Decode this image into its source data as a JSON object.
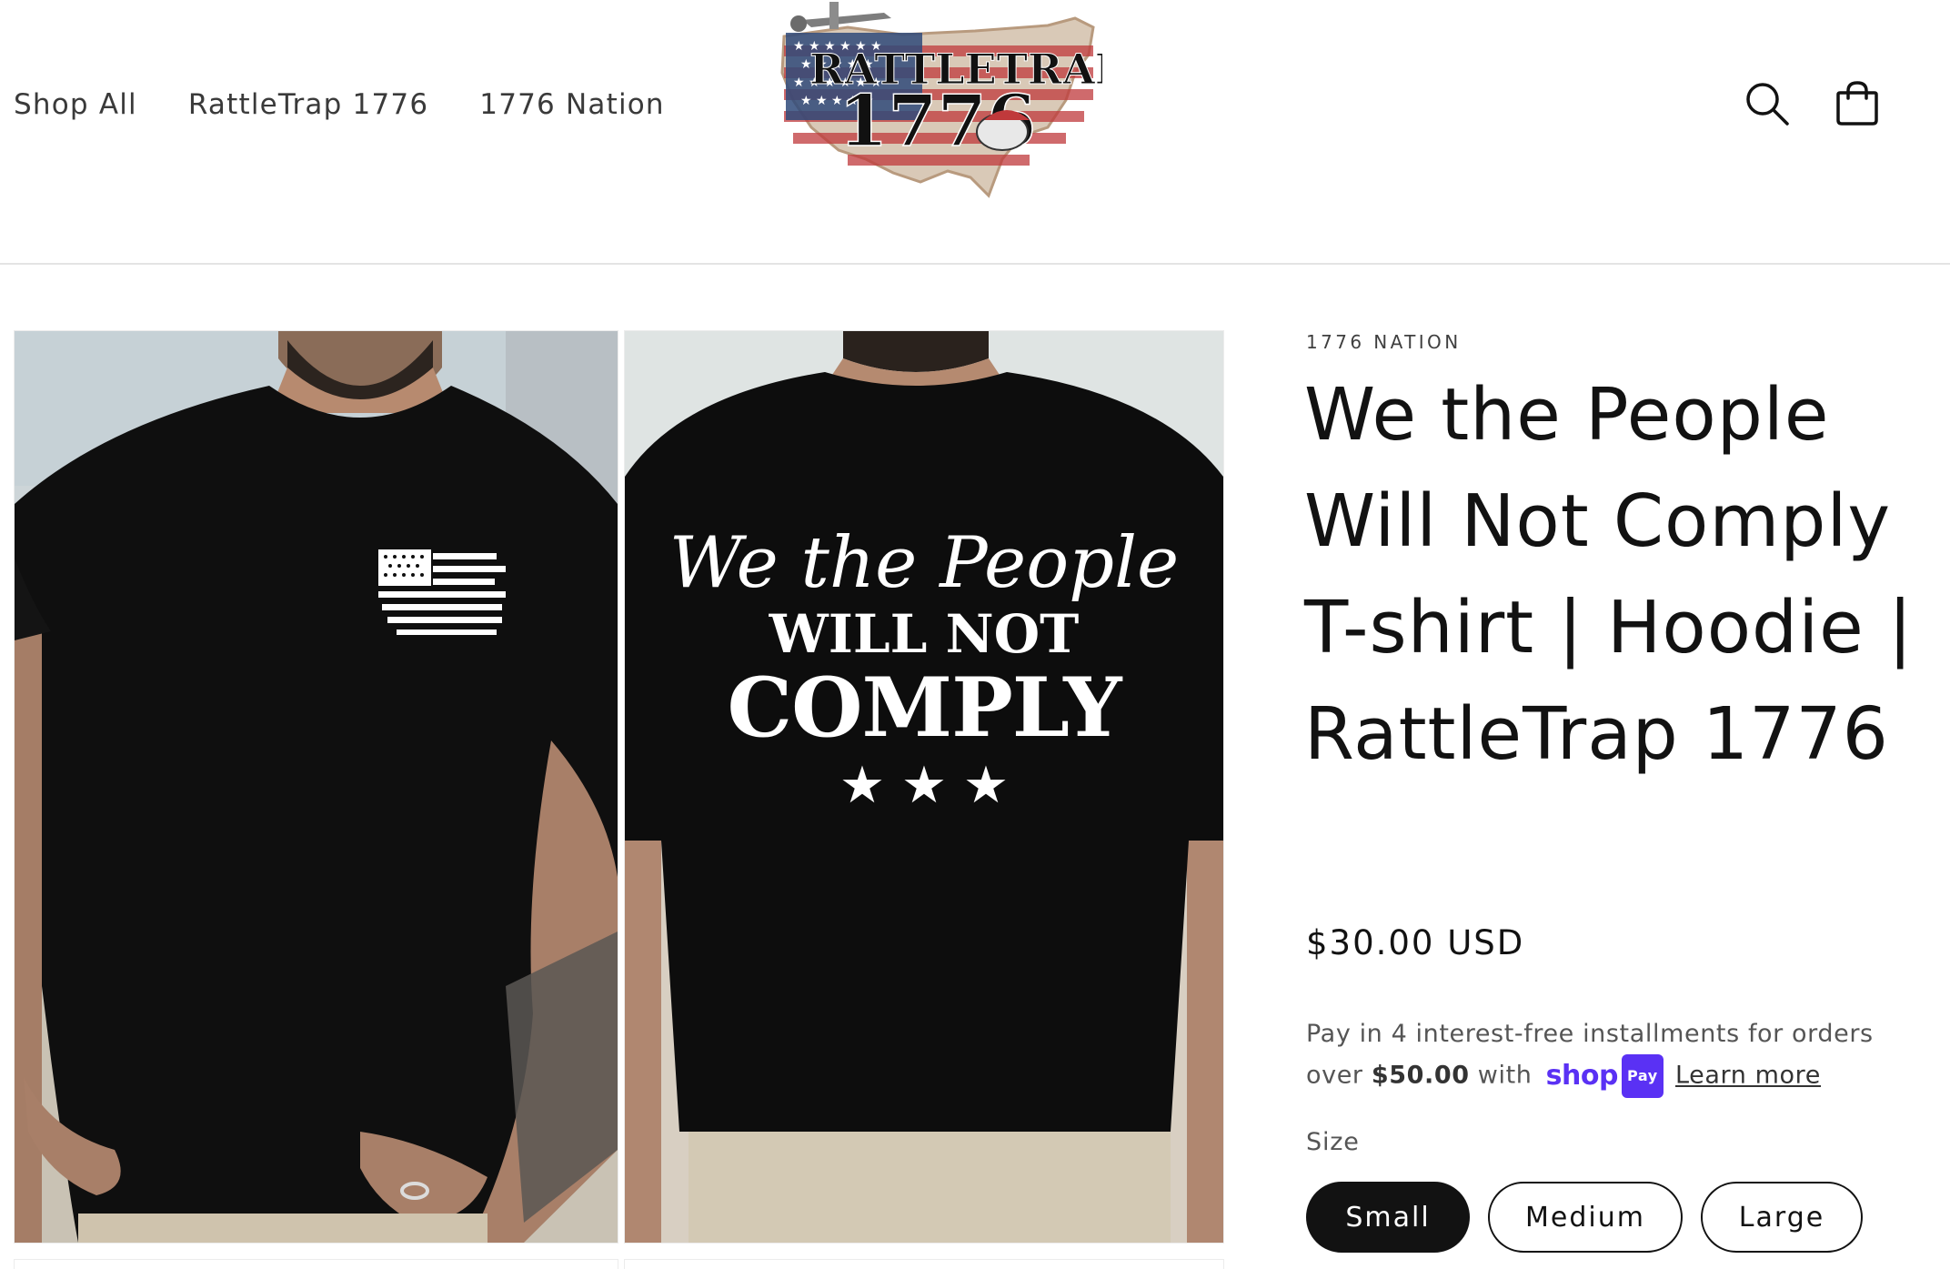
{
  "header": {
    "nav": [
      "Shop All",
      "RattleTrap 1776",
      "1776 Nation"
    ],
    "logo_text_line1": "RATTLETRAP",
    "logo_text_line2": "1776"
  },
  "product": {
    "vendor": "1776 NATION",
    "title": "We the People Will Not Comply T-shirt | Hoodie | RattleTrap 1776",
    "price": "$30.00 USD",
    "installments": {
      "text_before": "Pay in 4 interest-free installments for orders over",
      "amount": "$50.00",
      "text_with": "with",
      "shop_word": "shop",
      "pay_word": "Pay",
      "learn_more": "Learn more"
    },
    "size_label": "Size",
    "sizes": [
      "Small",
      "Medium",
      "Large"
    ],
    "selected_size": "Small"
  },
  "gallery": {
    "shirt_back_line1": "We the People",
    "shirt_back_line2": "WILL NOT",
    "shirt_back_line3": "COMPLY",
    "shirt_back_stars": "★ ★ ★"
  },
  "colors": {
    "text": "#121212",
    "muted": "#555555",
    "shop_pay": "#5a31f4",
    "selected_pill": "#121212",
    "shirt": "#0d0d0d"
  },
  "icons": [
    "search-icon",
    "cart-icon"
  ]
}
